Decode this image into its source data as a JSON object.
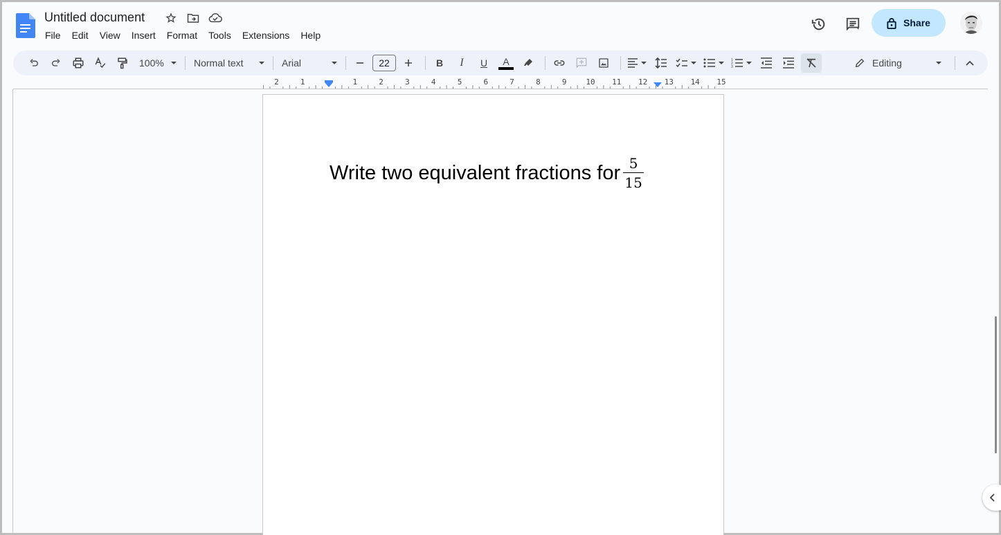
{
  "app": {
    "document_title": "Untitled document",
    "title_icons": [
      "star-icon",
      "move-to-folder-icon",
      "cloud-saved-icon"
    ],
    "menu": [
      "File",
      "Edit",
      "View",
      "Insert",
      "Format",
      "Tools",
      "Extensions",
      "Help"
    ],
    "share_label": "Share",
    "colors": {
      "brand_blue": "#4285f4",
      "share_bg": "#c2e7ff",
      "toolbar_bg": "#edf2fa",
      "ruler_marker": "#4285f4"
    }
  },
  "toolbar": {
    "zoom": "100%",
    "style": "Normal text",
    "font": "Arial",
    "font_size": "22",
    "bold": "B",
    "italic": "I",
    "underline": "U",
    "text_color": "A",
    "mode": "Editing"
  },
  "ruler": {
    "left_labels": [
      "2",
      "1"
    ],
    "right_labels": [
      "1",
      "2",
      "3",
      "4",
      "5",
      "6",
      "7",
      "8",
      "9",
      "10",
      "11",
      "12",
      "13",
      "14",
      "15"
    ]
  },
  "document": {
    "text": "Write two equivalent fractions for",
    "fraction": {
      "numerator": "5",
      "denominator": "15"
    }
  }
}
